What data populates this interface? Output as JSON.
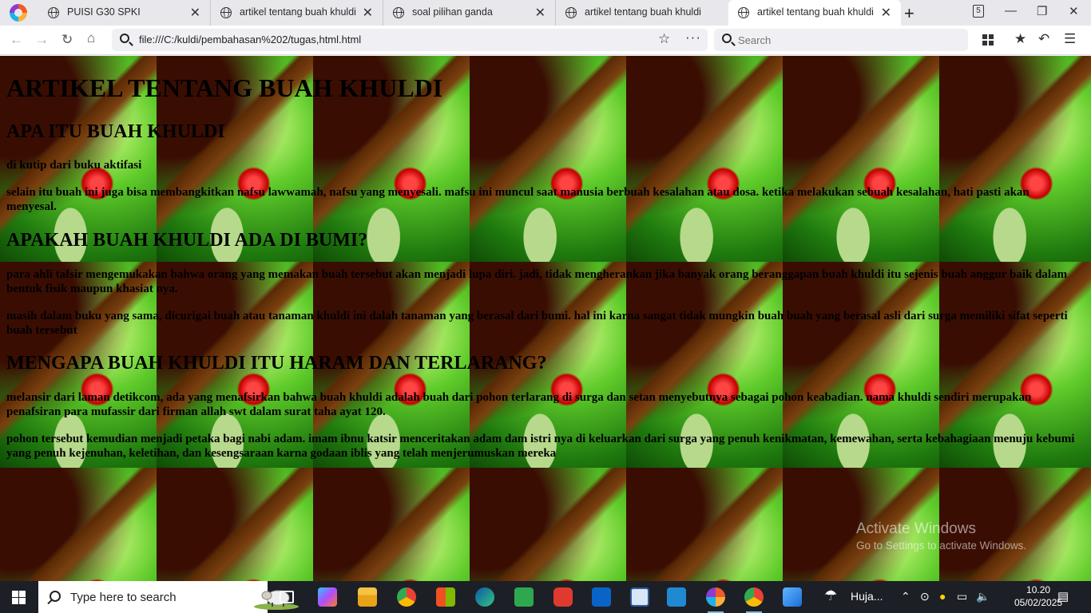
{
  "browser": {
    "tabs": [
      {
        "title": "PUISI G30 SPKI"
      },
      {
        "title": "artikel tentang buah khuldi"
      },
      {
        "title": "soal pilihan ganda"
      },
      {
        "title": "artikel tentang buah khuldi"
      },
      {
        "title": "artikel tentang buah khuldi",
        "active": true
      }
    ],
    "address": "file:///C:/kuldi/pembahasan%202/tugas,html.html",
    "search_placeholder": "Search",
    "icons": [
      "firefox-logo",
      "globe-icon",
      "close-icon",
      "plus-icon",
      "back-icon",
      "forward-icon",
      "reload-icon",
      "home-icon",
      "star-icon",
      "more-icon",
      "search-icon",
      "grid-icon",
      "bookmarks-icon",
      "undo-icon",
      "menu-icon"
    ]
  },
  "article": {
    "title": "ARTIKEL TENTANG BUAH KHULDI",
    "sections": [
      {
        "heading": "APA ITU BUAH KHULDI",
        "paragraphs": [
          "di kutip dari buku aktifasi",
          "selain itu buah ini juga bisa membangkitkan nafsu lawwamah, nafsu yang menyesali. mafsu ini muncul saat manusia berbuah kesalahan atau dosa. ketika melakukan sebuah kesalahan, hati pasti akan menyesal."
        ]
      },
      {
        "heading": "APAKAH BUAH KHULDI ADA DI BUMI?",
        "paragraphs": [
          "para ahli tafsir mengemukakan bahwa orang yang memakan buah tersebut akan menjadi lupa diri. jadi, tidak mengherankan jika banyak orang beranggapan buah khuldi itu sejenis buah anggur baik dalam bentuk fisik maupun khasiat nya.",
          "masih dalam buku yang sama, dicurigai buah atau tanaman khuldi ini dalah tanaman yang berasal dari bumi. hal ini karna sangat tidak mungkin buah buah yang berasal asli dari surga memiliki sifat seperti buah tersebut"
        ]
      },
      {
        "heading": "MENGAPA BUAH KHULDI ITU HARAM DAN TERLARANG?",
        "paragraphs": [
          "melansir dari laman detikcom, ada yang menafsirkan bahwa buah khuldi adalah buah dari pohon terlarang di surga dan setan menyebutnya sebagai pohon keabadian. nama khuldi sendiri merupakan penafsiran para mufassir dari firman allah swt dalam surat taha ayat 120.",
          "pohon tersebut kemudian menjadi petaka bagi nabi adam. imam ibnu katsir menceritakan adam dam istri nya di keluarkan dari surga yang penuh kenikmatan, kemewahan, serta kebahagiaan menuju kebumi yang penuh kejenuhan, keletihan, dan kesengsaraan karna godaan iblis yang telah menjerumuskan mereka"
        ]
      }
    ]
  },
  "watermark": {
    "line1": "Activate Windows",
    "line2": "Go to Settings to activate Windows."
  },
  "taskbar": {
    "search_placeholder": "Type here to search",
    "weather": "Huja...",
    "time": "10.20",
    "date": "05/02/2025",
    "apps": [
      "task-view",
      "copilot",
      "file-explorer",
      "chrome",
      "microsoft-store",
      "edge",
      "wps-office",
      "outlook",
      "news",
      "vscode",
      "firefox",
      "chrome-profile",
      "paint"
    ]
  },
  "colors": {
    "tabbar": "#e8e8ec",
    "active_tab": "#ffffff",
    "taskbar": "#1d1f26",
    "page_green": "#2c8a16"
  }
}
